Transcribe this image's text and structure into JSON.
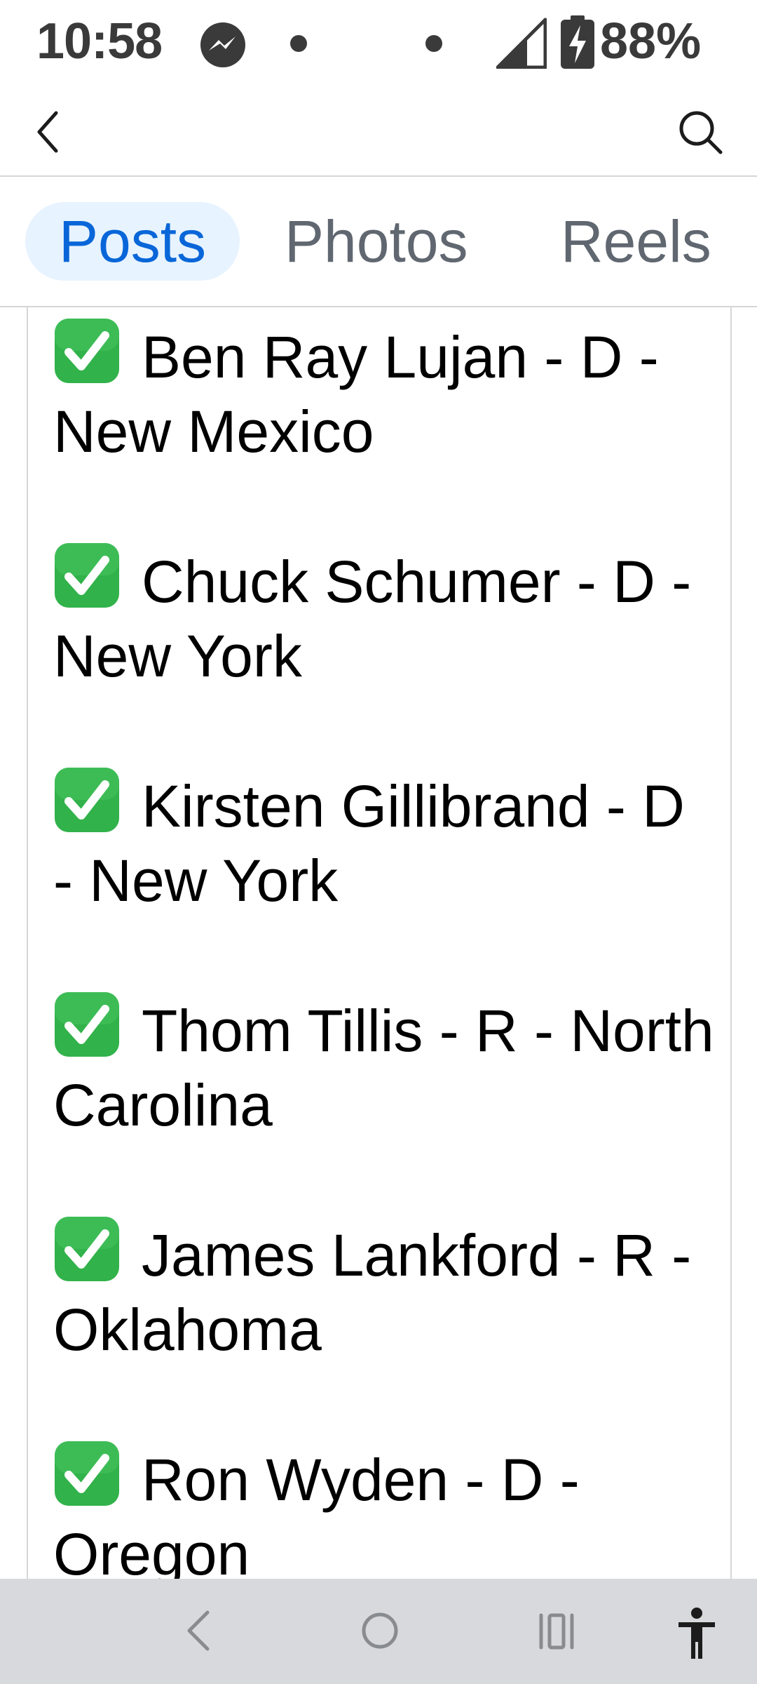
{
  "status_bar": {
    "time": "10:58",
    "battery": "88%",
    "icons": [
      "messenger-icon",
      "dot",
      "dot",
      "signal-icon",
      "battery-charging-icon"
    ]
  },
  "app_bar": {
    "icons": [
      "back-icon",
      "search-icon"
    ]
  },
  "tabs": [
    {
      "label": "Posts",
      "active": true
    },
    {
      "label": "Photos",
      "active": false
    },
    {
      "label": "Reels",
      "active": false
    }
  ],
  "post": {
    "check_icon": "white-check-mark-emoji",
    "lines": [
      "Ben Ray Lujan - D - New Mexico",
      "Chuck Schumer - D - New York",
      "Kirsten Gillibrand - D - New York",
      "Thom Tillis - R - North Carolina",
      "James Lankford - R - Oklahoma",
      "Ron Wyden - D - Oregon"
    ]
  },
  "nav_bar": {
    "icons": [
      "back-icon",
      "home-icon",
      "recents-icon",
      "accessibility-icon"
    ]
  },
  "colors": {
    "tab_active_text": "#0866d8",
    "tab_active_bg": "#e7f3ff",
    "tab_inactive_text": "#606770",
    "check_green": "#31b24a",
    "nav_bar_bg": "#d8d9dc"
  }
}
